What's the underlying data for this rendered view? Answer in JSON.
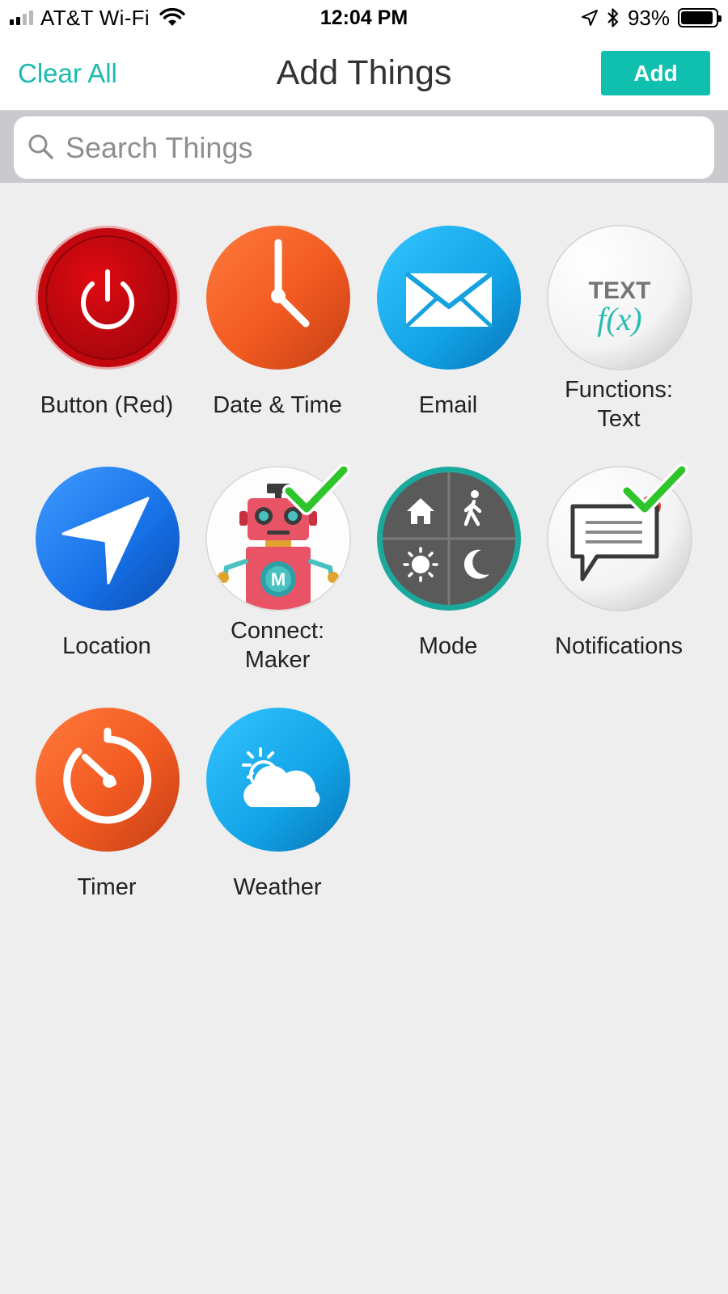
{
  "status_bar": {
    "carrier": "AT&T Wi-Fi",
    "time": "12:04 PM",
    "battery_percent": "93%",
    "battery_level": 0.93
  },
  "nav": {
    "clear_all_label": "Clear All",
    "title": "Add Things",
    "add_label": "Add"
  },
  "search": {
    "placeholder": "Search Things"
  },
  "things": [
    {
      "label": "Button (Red)",
      "icon": "power-button-icon",
      "selected": false
    },
    {
      "label": "Date & Time",
      "icon": "clock-icon",
      "selected": false
    },
    {
      "label": "Email",
      "icon": "envelope-icon",
      "selected": false
    },
    {
      "label": "Functions: Text",
      "icon": "text-function-icon",
      "selected": false
    },
    {
      "label": "Location",
      "icon": "location-arrow-icon",
      "selected": false
    },
    {
      "label": "Connect: Maker",
      "icon": "maker-robot-icon",
      "selected": true
    },
    {
      "label": "Mode",
      "icon": "mode-icon",
      "selected": false
    },
    {
      "label": "Notifications",
      "icon": "notification-bubble-icon",
      "selected": true
    },
    {
      "label": "Timer",
      "icon": "timer-icon",
      "selected": false
    },
    {
      "label": "Weather",
      "icon": "weather-cloud-icon",
      "selected": false
    }
  ],
  "colors": {
    "accent": "#10c0af",
    "link": "#1ebab0",
    "background": "#eeeeef",
    "check": "#2dc52a"
  }
}
